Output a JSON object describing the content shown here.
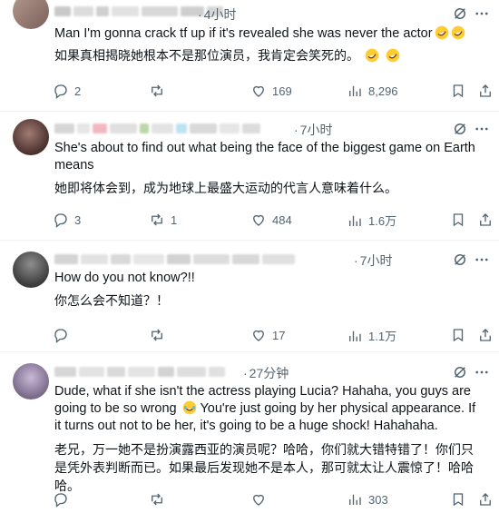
{
  "colors": {
    "muted": "#536471",
    "text": "#0f1419",
    "divider": "#eff3f4"
  },
  "tweets": [
    {
      "time": "4小时",
      "text_en": "Man I'm gonna crack tf up if it's revealed she was never the actor",
      "text_zh": "如果真相揭晓她根本不是那位演员，我肯定会笑死的。",
      "replies": "2",
      "retweets": "",
      "likes": "169",
      "views": "8,296"
    },
    {
      "time": "7小时",
      "text_en": "She's about to find out what being the face of the biggest game on Earth means",
      "text_zh": "她即将体会到，成为地球上最盛大运动的代言人意味着什么。",
      "replies": "3",
      "retweets": "1",
      "likes": "484",
      "views": "1.6万"
    },
    {
      "time": "7小时",
      "text_en": "How do you not know?!!",
      "text_zh": "你怎么会不知道？！",
      "replies": "",
      "retweets": "",
      "likes": "17",
      "views": "1.1万"
    },
    {
      "time": "27分钟",
      "text_en_1": "Dude, what if she isn't the actress playing Lucia? Hahaha, you guys are going to be so wrong",
      "text_en_2": "You're just going by her physical appearance. If it turns out not to be her, it's going to be a huge shock! Hahahaha.",
      "text_zh": "老兄，万一她不是扮演露西亚的演员呢？哈哈，你们就大错特错了！你们只是凭外表判断而已。如果最后发现她不是本人，那可就太让人震惊了！哈哈哈。",
      "replies": "",
      "retweets": "",
      "likes": "",
      "views": "303"
    }
  ]
}
